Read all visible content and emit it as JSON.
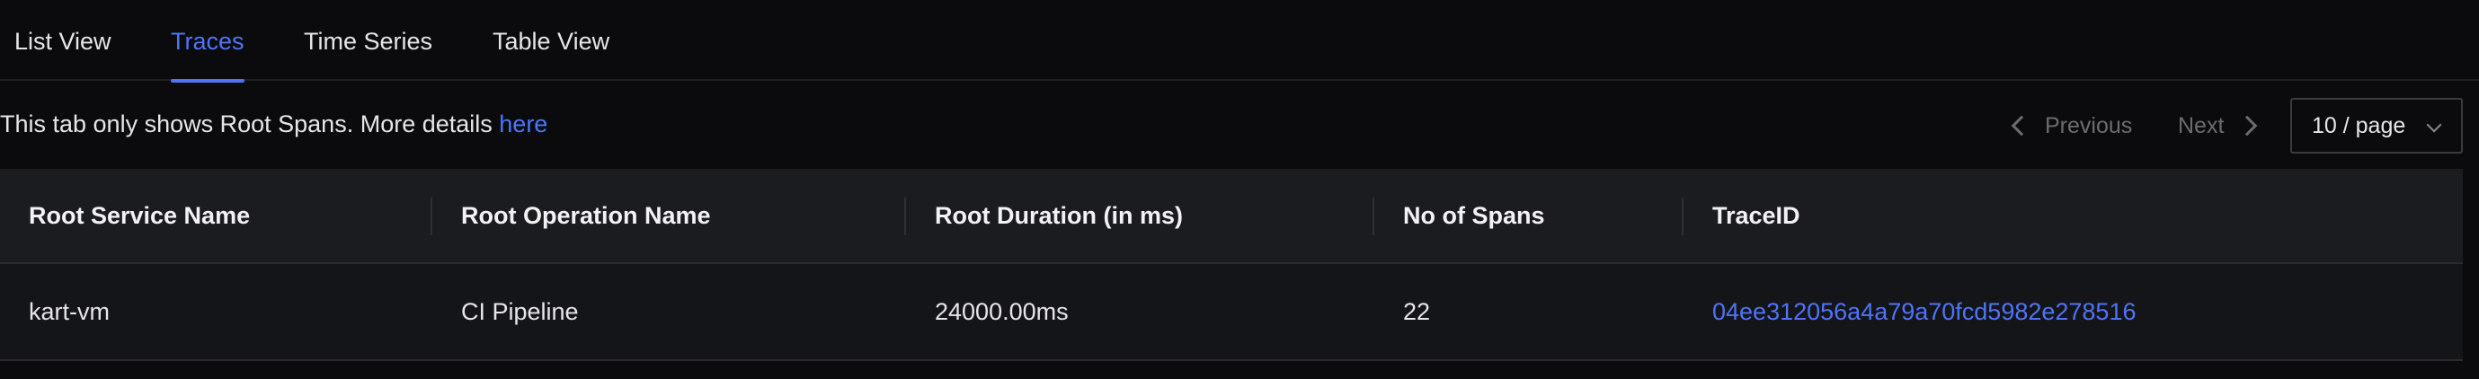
{
  "tabs": [
    {
      "label": "List View",
      "active": false
    },
    {
      "label": "Traces",
      "active": true
    },
    {
      "label": "Time Series",
      "active": false
    },
    {
      "label": "Table View",
      "active": false
    }
  ],
  "info": {
    "text": "This tab only shows Root Spans. More details ",
    "link_label": "here"
  },
  "pagination": {
    "previous_label": "Previous",
    "next_label": "Next",
    "page_size": "10 / page"
  },
  "table": {
    "columns": [
      "Root Service Name",
      "Root Operation Name",
      "Root Duration (in ms)",
      "No of Spans",
      "TraceID"
    ],
    "rows": [
      {
        "service": "kart-vm",
        "operation": "CI Pipeline",
        "duration": "24000.00ms",
        "spans": "22",
        "trace_id": "04ee312056a4a79a70fcd5982e278516"
      }
    ]
  },
  "colors": {
    "accent": "#4e74f8",
    "background": "#0b0b0d",
    "header_bg": "#1b1c20",
    "row_bg": "#141518"
  }
}
